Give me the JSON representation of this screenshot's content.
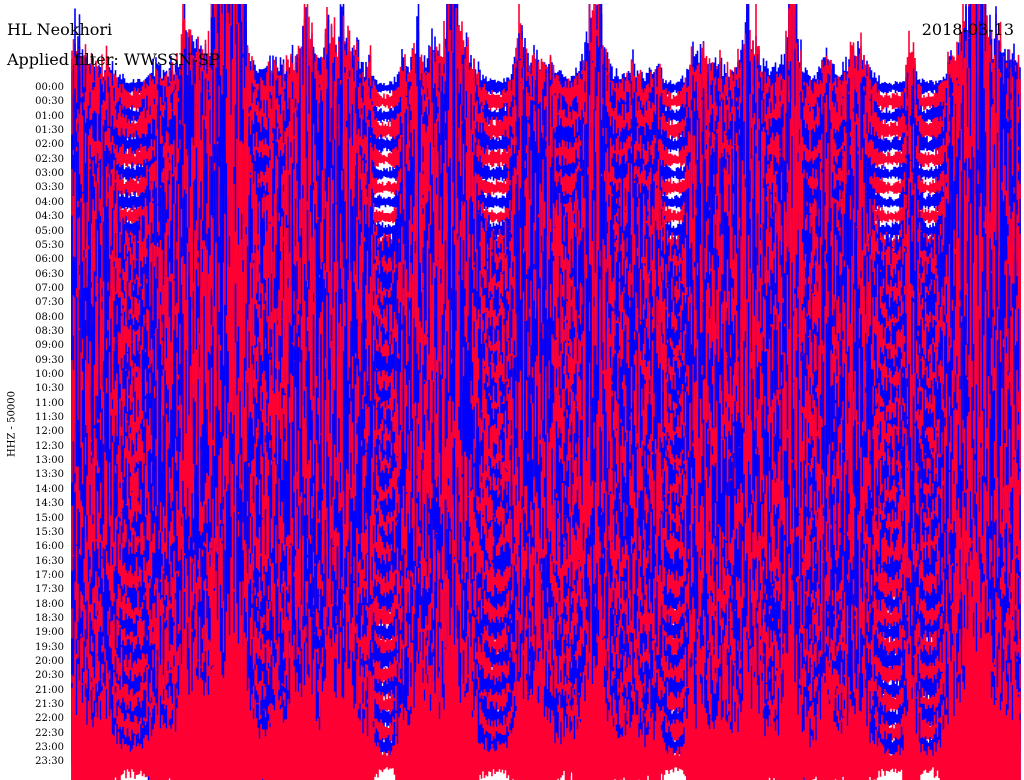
{
  "header": {
    "station": "HL Neokhori",
    "filter": "Applied filter: WWSSN-SP",
    "date": "2018-03-13"
  },
  "chart_data": {
    "type": "line",
    "title": "HL Neokhori",
    "ylabel": "HHZ - 50000",
    "row_labels": [
      "00:00",
      "00:30",
      "01:00",
      "01:30",
      "02:00",
      "02:30",
      "03:00",
      "03:30",
      "04:00",
      "04:30",
      "05:00",
      "05:30",
      "06:00",
      "06:30",
      "07:00",
      "07:30",
      "08:00",
      "08:30",
      "09:00",
      "09:30",
      "10:00",
      "10:30",
      "11:00",
      "11:30",
      "12:00",
      "12:30",
      "13:00",
      "13:30",
      "14:00",
      "14:30",
      "15:00",
      "15:30",
      "16:00",
      "16:30",
      "17:00",
      "17:30",
      "18:00",
      "18:30",
      "19:00",
      "19:30",
      "20:00",
      "20:30",
      "21:00",
      "21:30",
      "22:00",
      "22:30",
      "23:00",
      "23:30"
    ],
    "row_colors": [
      "#0000ff",
      "#ff0033"
    ],
    "activity_per_row": [
      0.12,
      0.22,
      0.18,
      0.28,
      0.2,
      0.16,
      0.12,
      0.14,
      0.12,
      0.14,
      0.18,
      0.35,
      0.85,
      0.95,
      1,
      1,
      1,
      1,
      1,
      1,
      1,
      1,
      1,
      1,
      1,
      1,
      1,
      1,
      1,
      1,
      1,
      1,
      1,
      0.95,
      0.85,
      0.7,
      0.5,
      0.42,
      0.38,
      0.42,
      0.45,
      0.4,
      0.35,
      0.35,
      0.38,
      0.4,
      0.42,
      0.45
    ]
  }
}
